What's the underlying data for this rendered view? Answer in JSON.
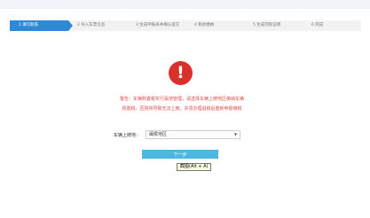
{
  "steps": [
    {
      "label": "1 填写联系",
      "active": true
    },
    {
      "label": "2 导入车票信息",
      "active": false
    },
    {
      "label": "3 生成申报表并确认提交",
      "active": false
    },
    {
      "label": "4 税款缴纳",
      "active": false
    },
    {
      "label": "5 生成完税证明",
      "active": false
    },
    {
      "label": "6 完成",
      "active": false
    }
  ],
  "warning": {
    "icon": "exclamation-icon",
    "line1": "警告：车辆购置税实行属地管理，请选择车辆上牌地区缴纳车辆",
    "line2": "购置税，否则将导致无法上牌，并须办理退税后重新申报缴税"
  },
  "form": {
    "label": "车辆上牌地：",
    "selected": "闽侯地区"
  },
  "next_button": "下一步",
  "tooltip": "截图(Alt + A)"
}
